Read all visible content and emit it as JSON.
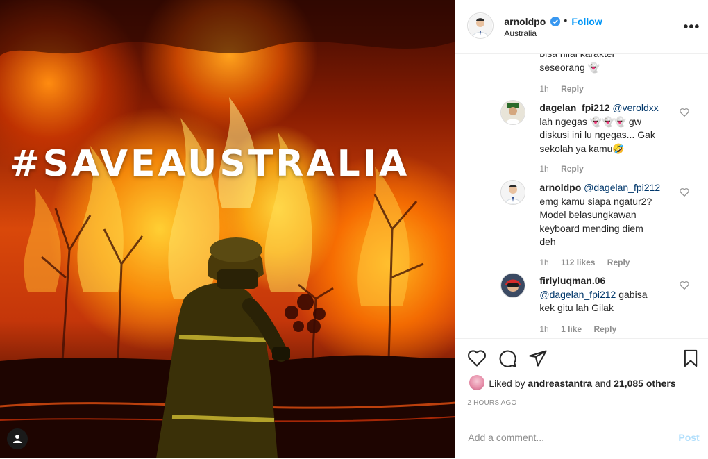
{
  "image": {
    "hashtag": "#SAVEAUSTRALIA",
    "tag_icon": "person-icon"
  },
  "header": {
    "username": "arnoldpo",
    "verified_icon": "verified-badge-icon",
    "separator": "•",
    "follow_label": "Follow",
    "location": "Australia",
    "more_icon": "more-options-icon"
  },
  "comments": [
    {
      "text_lines": [
        "bisa nilai karakter",
        "seseorang 👻"
      ],
      "time": "1h",
      "reply_label": "Reply"
    },
    {
      "username": "dagelan_fpi212",
      "mention": "@veroldxx",
      "text": "lah ngegas 👻👻👻 gw diskusi ini lu ngegas... Gak sekolah ya kamu🤣",
      "line1_rest": "lah ngegas 👻👻👻 gw",
      "line2": "diskusi ini lu ngegas... Gak",
      "line3": "sekolah ya kamu🤣",
      "time": "1h",
      "reply_label": "Reply"
    },
    {
      "username": "arnoldpo",
      "mention": "@dagelan_fpi212",
      "line1": "emg kamu siapa ngatur2?",
      "line2": "Model belasungkawan",
      "line3": "keyboard mending diem",
      "line4": "deh",
      "time": "1h",
      "likes": "112 likes",
      "reply_label": "Reply"
    },
    {
      "username": "firlyluqman.06",
      "mention": "@dagelan_fpi212",
      "line1_rest": "gabisa",
      "line2": "kek gitu lah Gilak",
      "time": "1h",
      "likes": "1 like",
      "reply_label": "Reply"
    }
  ],
  "actions": {
    "like_icon": "heart-icon",
    "comment_icon": "comment-icon",
    "share_icon": "paper-plane-icon",
    "save_icon": "bookmark-icon",
    "liked_by_prefix": "Liked by",
    "liked_by_user": "andreastantra",
    "liked_by_and": "and",
    "liked_by_count": "21,085 others",
    "posted_ago": "2 HOURS AGO"
  },
  "add_comment": {
    "placeholder": "Add a comment...",
    "post_label": "Post"
  },
  "colors": {
    "accent": "#0095f6",
    "mention": "#00376b",
    "muted": "#8e8e8e",
    "post_disabled": "#b2dffc"
  }
}
